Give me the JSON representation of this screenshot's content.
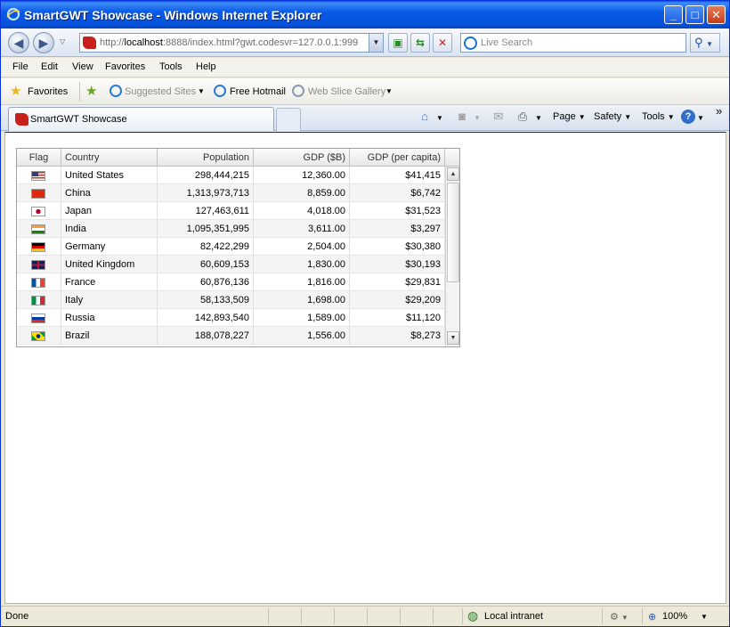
{
  "window": {
    "title": "SmartGWT Showcase - Windows Internet Explorer",
    "minimize_glyph": "_",
    "maximize_glyph": "□",
    "close_glyph": "✕"
  },
  "address_bar": {
    "url_prefix": "http://",
    "url_host": "localhost",
    "url_rest": ":8888/index.html?gwt.codesvr=127.0.0.1:999",
    "search_placeholder": "Live Search"
  },
  "menu": [
    "File",
    "Edit",
    "View",
    "Favorites",
    "Tools",
    "Help"
  ],
  "favorites_bar": {
    "favorites_label": "Favorites",
    "suggested_sites": "Suggested Sites",
    "free_hotmail": "Free Hotmail",
    "web_slice_gallery": "Web Slice Gallery"
  },
  "tab": {
    "label": "SmartGWT Showcase"
  },
  "command_bar": {
    "page": "Page",
    "safety": "Safety",
    "tools": "Tools",
    "more": "»"
  },
  "grid": {
    "headers": {
      "flag": "Flag",
      "country": "Country",
      "population": "Population",
      "gdp": "GDP ($B)",
      "gdp_per_capita": "GDP (per capita)"
    },
    "rows": [
      {
        "country": "United States",
        "population": "298,444,215",
        "gdp": "12,360.00",
        "gdp_pc": "$41,415",
        "flag": "us"
      },
      {
        "country": "China",
        "population": "1,313,973,713",
        "gdp": "8,859.00",
        "gdp_pc": "$6,742",
        "flag": "cn"
      },
      {
        "country": "Japan",
        "population": "127,463,611",
        "gdp": "4,018.00",
        "gdp_pc": "$31,523",
        "flag": "jp"
      },
      {
        "country": "India",
        "population": "1,095,351,995",
        "gdp": "3,611.00",
        "gdp_pc": "$3,297",
        "flag": "in"
      },
      {
        "country": "Germany",
        "population": "82,422,299",
        "gdp": "2,504.00",
        "gdp_pc": "$30,380",
        "flag": "de"
      },
      {
        "country": "United Kingdom",
        "population": "60,609,153",
        "gdp": "1,830.00",
        "gdp_pc": "$30,193",
        "flag": "gb"
      },
      {
        "country": "France",
        "population": "60,876,136",
        "gdp": "1,816.00",
        "gdp_pc": "$29,831",
        "flag": "fr"
      },
      {
        "country": "Italy",
        "population": "58,133,509",
        "gdp": "1,698.00",
        "gdp_pc": "$29,209",
        "flag": "it"
      },
      {
        "country": "Russia",
        "population": "142,893,540",
        "gdp": "1,589.00",
        "gdp_pc": "$11,120",
        "flag": "ru"
      },
      {
        "country": "Brazil",
        "population": "188,078,227",
        "gdp": "1,556.00",
        "gdp_pc": "$8,273",
        "flag": "br"
      }
    ]
  },
  "status_bar": {
    "status": "Done",
    "zone": "Local intranet",
    "zoom": "100%"
  }
}
